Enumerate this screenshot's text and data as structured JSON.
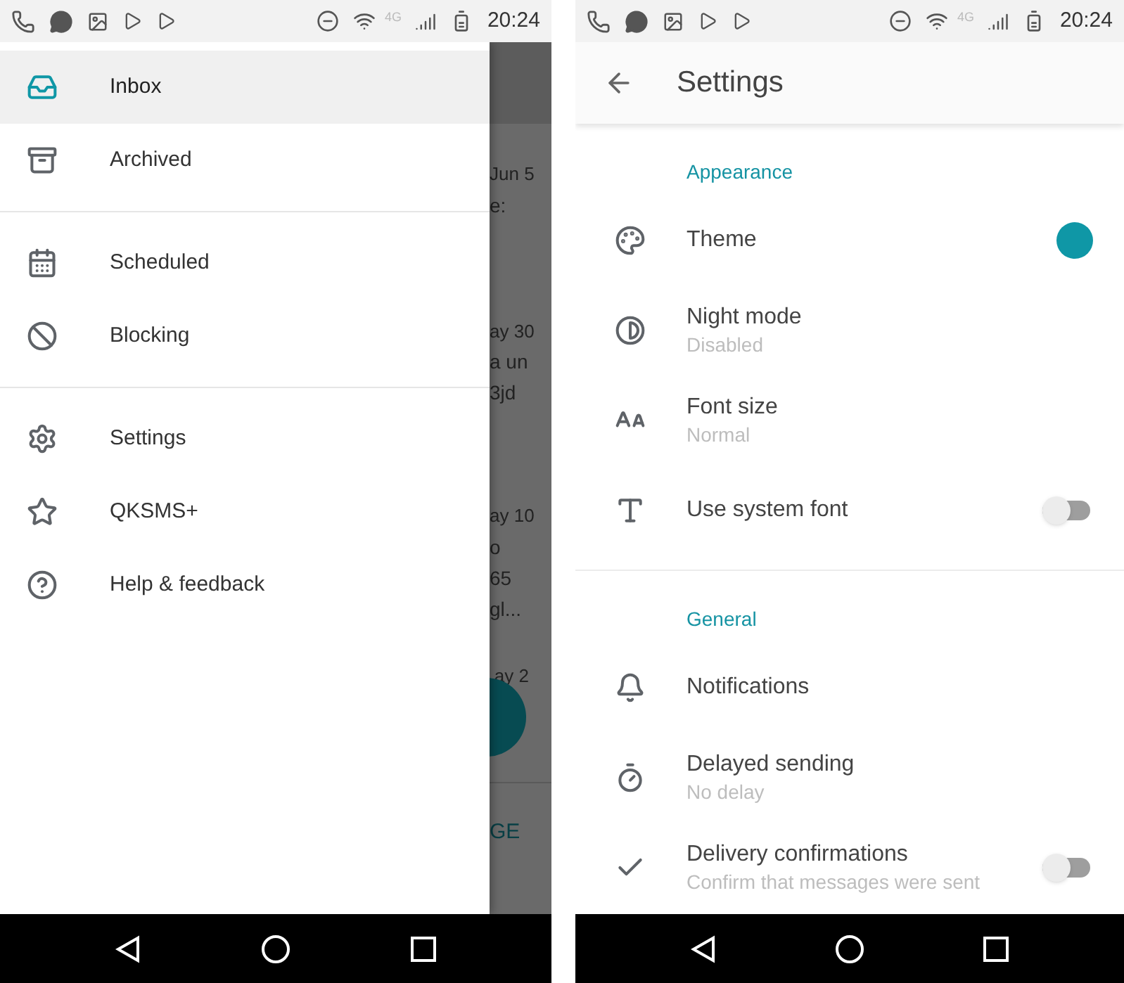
{
  "left_screen": {
    "status_bar": {
      "network": "4G",
      "time": "20:24"
    },
    "drawer": {
      "sections": [
        {
          "items": [
            {
              "label": "Inbox",
              "selected": true
            },
            {
              "label": "Archived",
              "selected": false
            }
          ]
        },
        {
          "items": [
            {
              "label": "Scheduled",
              "selected": false
            },
            {
              "label": "Blocking",
              "selected": false
            }
          ]
        },
        {
          "items": [
            {
              "label": "Settings",
              "selected": false
            },
            {
              "label": "QKSMS+",
              "selected": false
            },
            {
              "label": "Help & feedback",
              "selected": false
            }
          ]
        }
      ]
    },
    "dimmed_inbox": {
      "rows": [
        {
          "date": "Jun 5",
          "lines": [
            "e:"
          ]
        },
        {
          "date": "ay 30",
          "lines": [
            "a un",
            "3jd"
          ]
        },
        {
          "date": "ay 10",
          "lines": [
            "o",
            "65",
            "gl..."
          ]
        },
        {
          "date": "ay 2",
          "lines": []
        }
      ],
      "bottom_action": "GE"
    }
  },
  "right_screen": {
    "status_bar": {
      "network": "4G",
      "time": "20:24"
    },
    "title": "Settings",
    "groups": [
      {
        "heading": "Appearance",
        "items": [
          {
            "kind": "color",
            "title": "Theme",
            "color": "#0f97a6"
          },
          {
            "kind": "text",
            "title": "Night mode",
            "subtitle": "Disabled"
          },
          {
            "kind": "text",
            "title": "Font size",
            "subtitle": "Normal"
          },
          {
            "kind": "toggle",
            "title": "Use system font",
            "on": false
          }
        ]
      },
      {
        "heading": "General",
        "items": [
          {
            "kind": "text",
            "title": "Notifications"
          },
          {
            "kind": "text",
            "title": "Delayed sending",
            "subtitle": "No delay"
          },
          {
            "kind": "toggle",
            "title": "Delivery confirmations",
            "subtitle": "Confirm that messages were sent",
            "on": false
          }
        ]
      }
    ]
  }
}
